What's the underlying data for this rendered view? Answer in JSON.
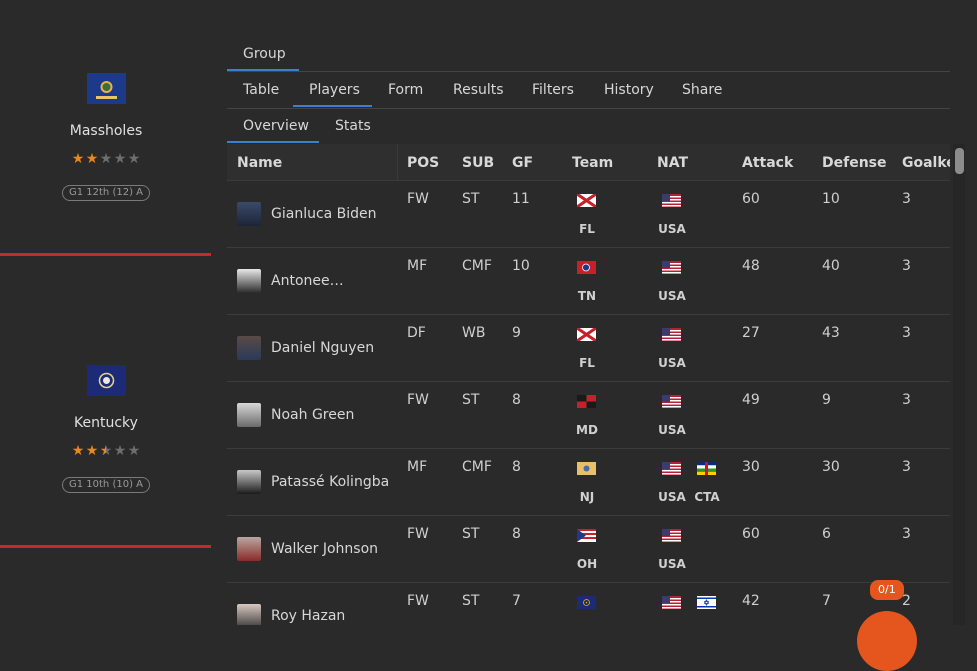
{
  "teams": [
    {
      "name": "Massholes",
      "badge": "G1 12th (12) A",
      "stars": 2.0
    },
    {
      "name": "Kentucky",
      "badge": "G1 10th (10) A",
      "stars": 2.5
    }
  ],
  "tabs": {
    "level1": [
      {
        "label": "Group",
        "active": true
      }
    ],
    "level2": [
      {
        "label": "Table"
      },
      {
        "label": "Players",
        "active": true
      },
      {
        "label": "Form"
      },
      {
        "label": "Results"
      },
      {
        "label": "Filters"
      },
      {
        "label": "History"
      },
      {
        "label": "Share"
      }
    ],
    "level3": [
      {
        "label": "Overview",
        "active": true
      },
      {
        "label": "Stats"
      }
    ]
  },
  "table": {
    "columns": [
      "Name",
      "POS",
      "SUB",
      "GF",
      "Team",
      "NAT",
      "Attack",
      "Defense",
      "Goalkee"
    ],
    "rows": [
      {
        "name": "Gianluca Biden",
        "pos": "FW",
        "sub": "ST",
        "gf": "11",
        "team": "FL",
        "nat": [
          "USA"
        ],
        "attack": "60",
        "defense": "10",
        "gk": "3"
      },
      {
        "name": "Antonee…",
        "pos": "MF",
        "sub": "CMF",
        "gf": "10",
        "team": "TN",
        "nat": [
          "USA"
        ],
        "attack": "48",
        "defense": "40",
        "gk": "3"
      },
      {
        "name": "Daniel Nguyen",
        "pos": "DF",
        "sub": "WB",
        "gf": "9",
        "team": "FL",
        "nat": [
          "USA"
        ],
        "attack": "27",
        "defense": "43",
        "gk": "3"
      },
      {
        "name": "Noah Green",
        "pos": "FW",
        "sub": "ST",
        "gf": "8",
        "team": "MD",
        "nat": [
          "USA"
        ],
        "attack": "49",
        "defense": "9",
        "gk": "3"
      },
      {
        "name": "Patassé Kolingba",
        "pos": "MF",
        "sub": "CMF",
        "gf": "8",
        "team": "NJ",
        "nat": [
          "USA",
          "CTA"
        ],
        "attack": "30",
        "defense": "30",
        "gk": "3"
      },
      {
        "name": "Walker Johnson",
        "pos": "FW",
        "sub": "ST",
        "gf": "8",
        "team": "OH",
        "nat": [
          "USA"
        ],
        "attack": "60",
        "defense": "6",
        "gk": "3"
      },
      {
        "name": "Roy Hazan",
        "pos": "FW",
        "sub": "ST",
        "gf": "7",
        "team": "",
        "nat": [
          "",
          ""
        ],
        "attack": "42",
        "defense": "7",
        "gk": "2"
      }
    ]
  },
  "counter": "0/1",
  "colors": {
    "accent": "#e8891e",
    "divider": "#c42a2a",
    "tab_active": "#3a7fd0",
    "fab": "#e4561d"
  }
}
